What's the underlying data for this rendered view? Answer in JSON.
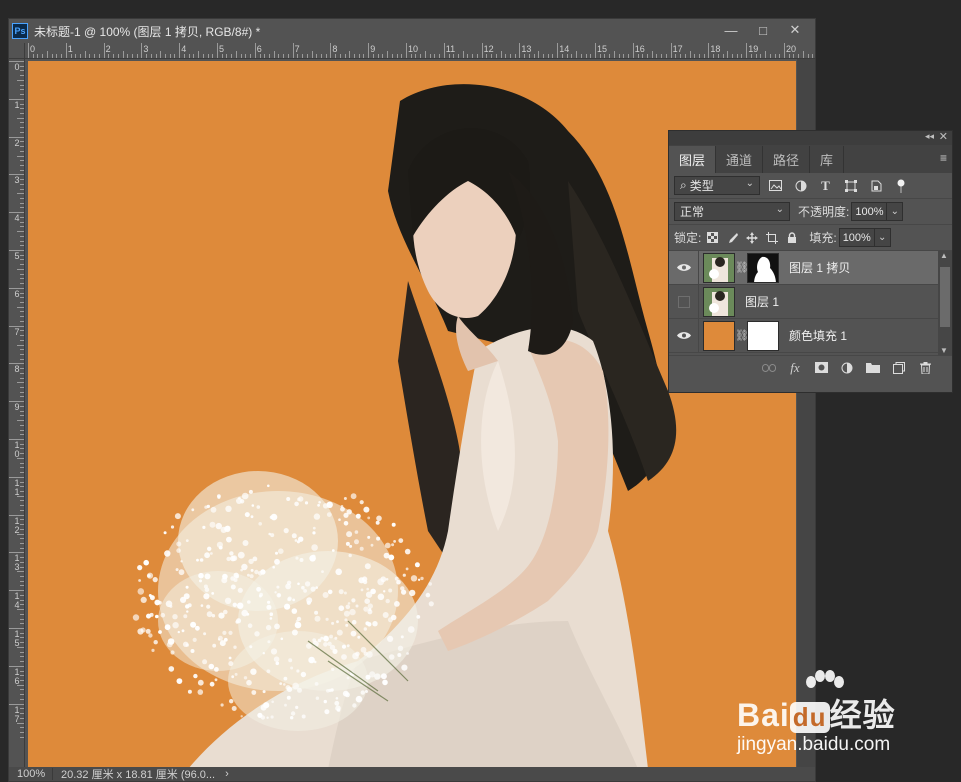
{
  "document": {
    "app_badge": "Ps",
    "title": "未标题-1 @ 100% (图层 1 拷贝, RGB/8#) *",
    "window_buttons": {
      "minimize": "—",
      "restore": "□",
      "close": "✕"
    },
    "ruler_h": [
      "0",
      "1",
      "2",
      "3",
      "4",
      "5",
      "6",
      "7",
      "8",
      "9",
      "10",
      "11",
      "12",
      "13",
      "14",
      "15",
      "16",
      "17",
      "18",
      "19",
      "20"
    ],
    "ruler_v": [
      "0",
      "1",
      "2",
      "3",
      "4",
      "5",
      "6",
      "7",
      "8",
      "9",
      "10",
      "11",
      "12",
      "13",
      "14",
      "15",
      "16",
      "17"
    ],
    "canvas_color": "#de8a3a",
    "status_zoom": "100%",
    "status_info": "20.32 厘米 x 18.81 厘米 (96.0...",
    "status_arrow": "›"
  },
  "layers_panel": {
    "collapse": "◂◂",
    "close": "✕",
    "tabs": [
      "图层",
      "通道",
      "路径",
      "库"
    ],
    "active_tab": 0,
    "menu_icon": "≡",
    "filter": {
      "search_icon": "⌕",
      "label": "类型",
      "caret": "⌄"
    },
    "filter_icons": [
      "image-filter-icon",
      "adjustment-filter-icon",
      "type-filter-icon",
      "shape-filter-icon",
      "smart-object-filter-icon",
      "filter-toggle-icon"
    ],
    "blend_mode": "正常",
    "opacity_label": "不透明度:",
    "opacity_value": "100%",
    "lock_label": "锁定:",
    "fill_label": "填充:",
    "fill_value": "100%",
    "layers": [
      {
        "name": "图层 1 拷贝",
        "visible": true,
        "selected": true,
        "has_mask": true
      },
      {
        "name": "图层 1",
        "visible": false,
        "selected": false,
        "has_mask": false
      },
      {
        "name": "颜色填充 1",
        "visible": true,
        "selected": false,
        "has_mask": true
      }
    ],
    "bottom_icons": [
      "link-layers-icon",
      "fx-icon",
      "add-mask-icon",
      "adjustment-layer-icon",
      "group-folder-icon",
      "new-layer-icon",
      "trash-icon"
    ],
    "fx_label": "fx"
  },
  "watermark": {
    "brand": "Bai",
    "du": "du",
    "cn": "经验",
    "url": "jingyan.baidu.com"
  }
}
